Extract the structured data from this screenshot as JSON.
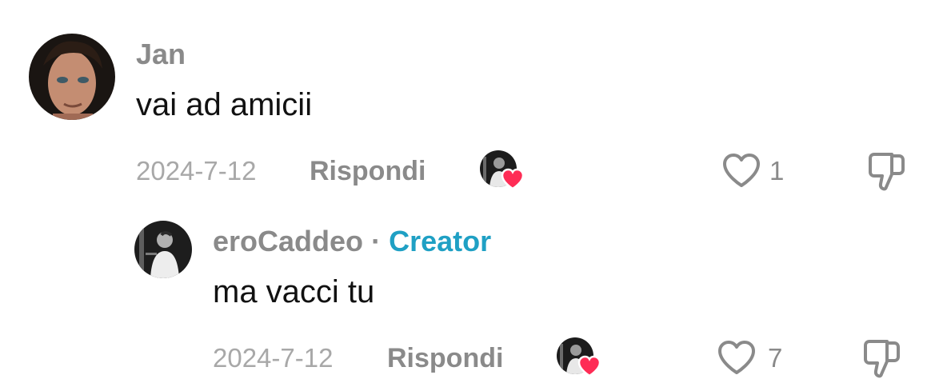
{
  "comments": [
    {
      "username": "Jan",
      "text": "vai ad amicii",
      "date": "2024-7-12",
      "reply_label": "Rispondi",
      "like_count": "1"
    },
    {
      "username": "eroCaddeo",
      "separator": "·",
      "badge": "Creator",
      "text": "ma vacci tu",
      "date": "2024-7-12",
      "reply_label": "Rispondi",
      "like_count": "7"
    }
  ],
  "colors": {
    "creator_badge": "#1fa0c4",
    "creator_heart": "#fe2c55",
    "muted_text": "#8a8a8a",
    "primary_text": "#111111"
  },
  "icons": [
    "heart-outline-icon",
    "thumbs-down-icon",
    "creator-liked-heart-icon"
  ]
}
